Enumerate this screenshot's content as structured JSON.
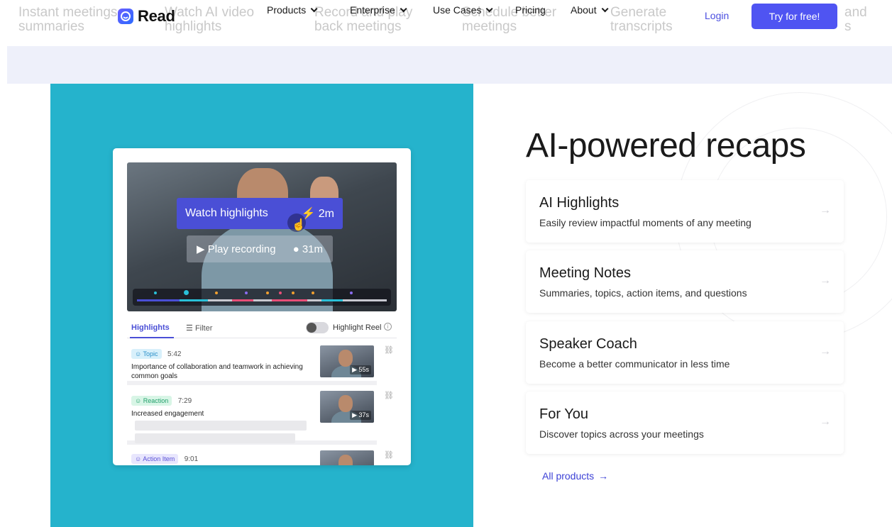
{
  "ghost_text": {
    "items": [
      {
        "line1": "Instant meetings",
        "line2": "summaries"
      },
      {
        "line1": "Watch AI video",
        "line2": "highlights"
      },
      {
        "line1": "Record and play",
        "line2": "back meetings"
      },
      {
        "line1": "Schedule better",
        "line2": "meetings"
      },
      {
        "line1": "Generate",
        "line2": "transcripts"
      },
      {
        "line1": "and",
        "line2": "s"
      }
    ]
  },
  "header": {
    "brand": "Read",
    "nav": [
      {
        "label": "Products",
        "has_dropdown": true
      },
      {
        "label": "Enterprise",
        "has_dropdown": true
      },
      {
        "label": "Use Cases",
        "has_dropdown": true
      },
      {
        "label": "Pricing",
        "has_dropdown": false
      },
      {
        "label": "About",
        "has_dropdown": true
      }
    ],
    "login": "Login",
    "cta": "Try for free!"
  },
  "demo": {
    "watch_label": "Watch highlights",
    "watch_duration": "2m",
    "play_label": "Play recording",
    "play_duration": "31m",
    "highlights_tab": "Highlights",
    "filter_label": "Filter",
    "reel_label": "Highlight Reel",
    "items": [
      {
        "tag": "Topic",
        "time": "5:42",
        "text": "Importance of collaboration and teamwork in achieving common goals",
        "thumb_duration": "55s"
      },
      {
        "tag": "Reaction",
        "time": "7:29",
        "text": "Increased engagement",
        "thumb_duration": "37s"
      },
      {
        "tag": "Action Item",
        "time": "9:01",
        "text": "",
        "thumb_duration": ""
      }
    ]
  },
  "section": {
    "headline": "AI-powered recaps",
    "features": [
      {
        "title": "AI Highlights",
        "desc": "Easily review impactful moments of any meeting"
      },
      {
        "title": "Meeting Notes",
        "desc": "Summaries, topics, action items, and questions"
      },
      {
        "title": "Speaker Coach",
        "desc": "Become a better communicator in less time"
      },
      {
        "title": "For You",
        "desc": "Discover topics across your meetings"
      }
    ],
    "all_products": "All products"
  },
  "colors": {
    "accent": "#4f54f2",
    "teal": "#25b3cc",
    "band": "#eef0fa"
  }
}
